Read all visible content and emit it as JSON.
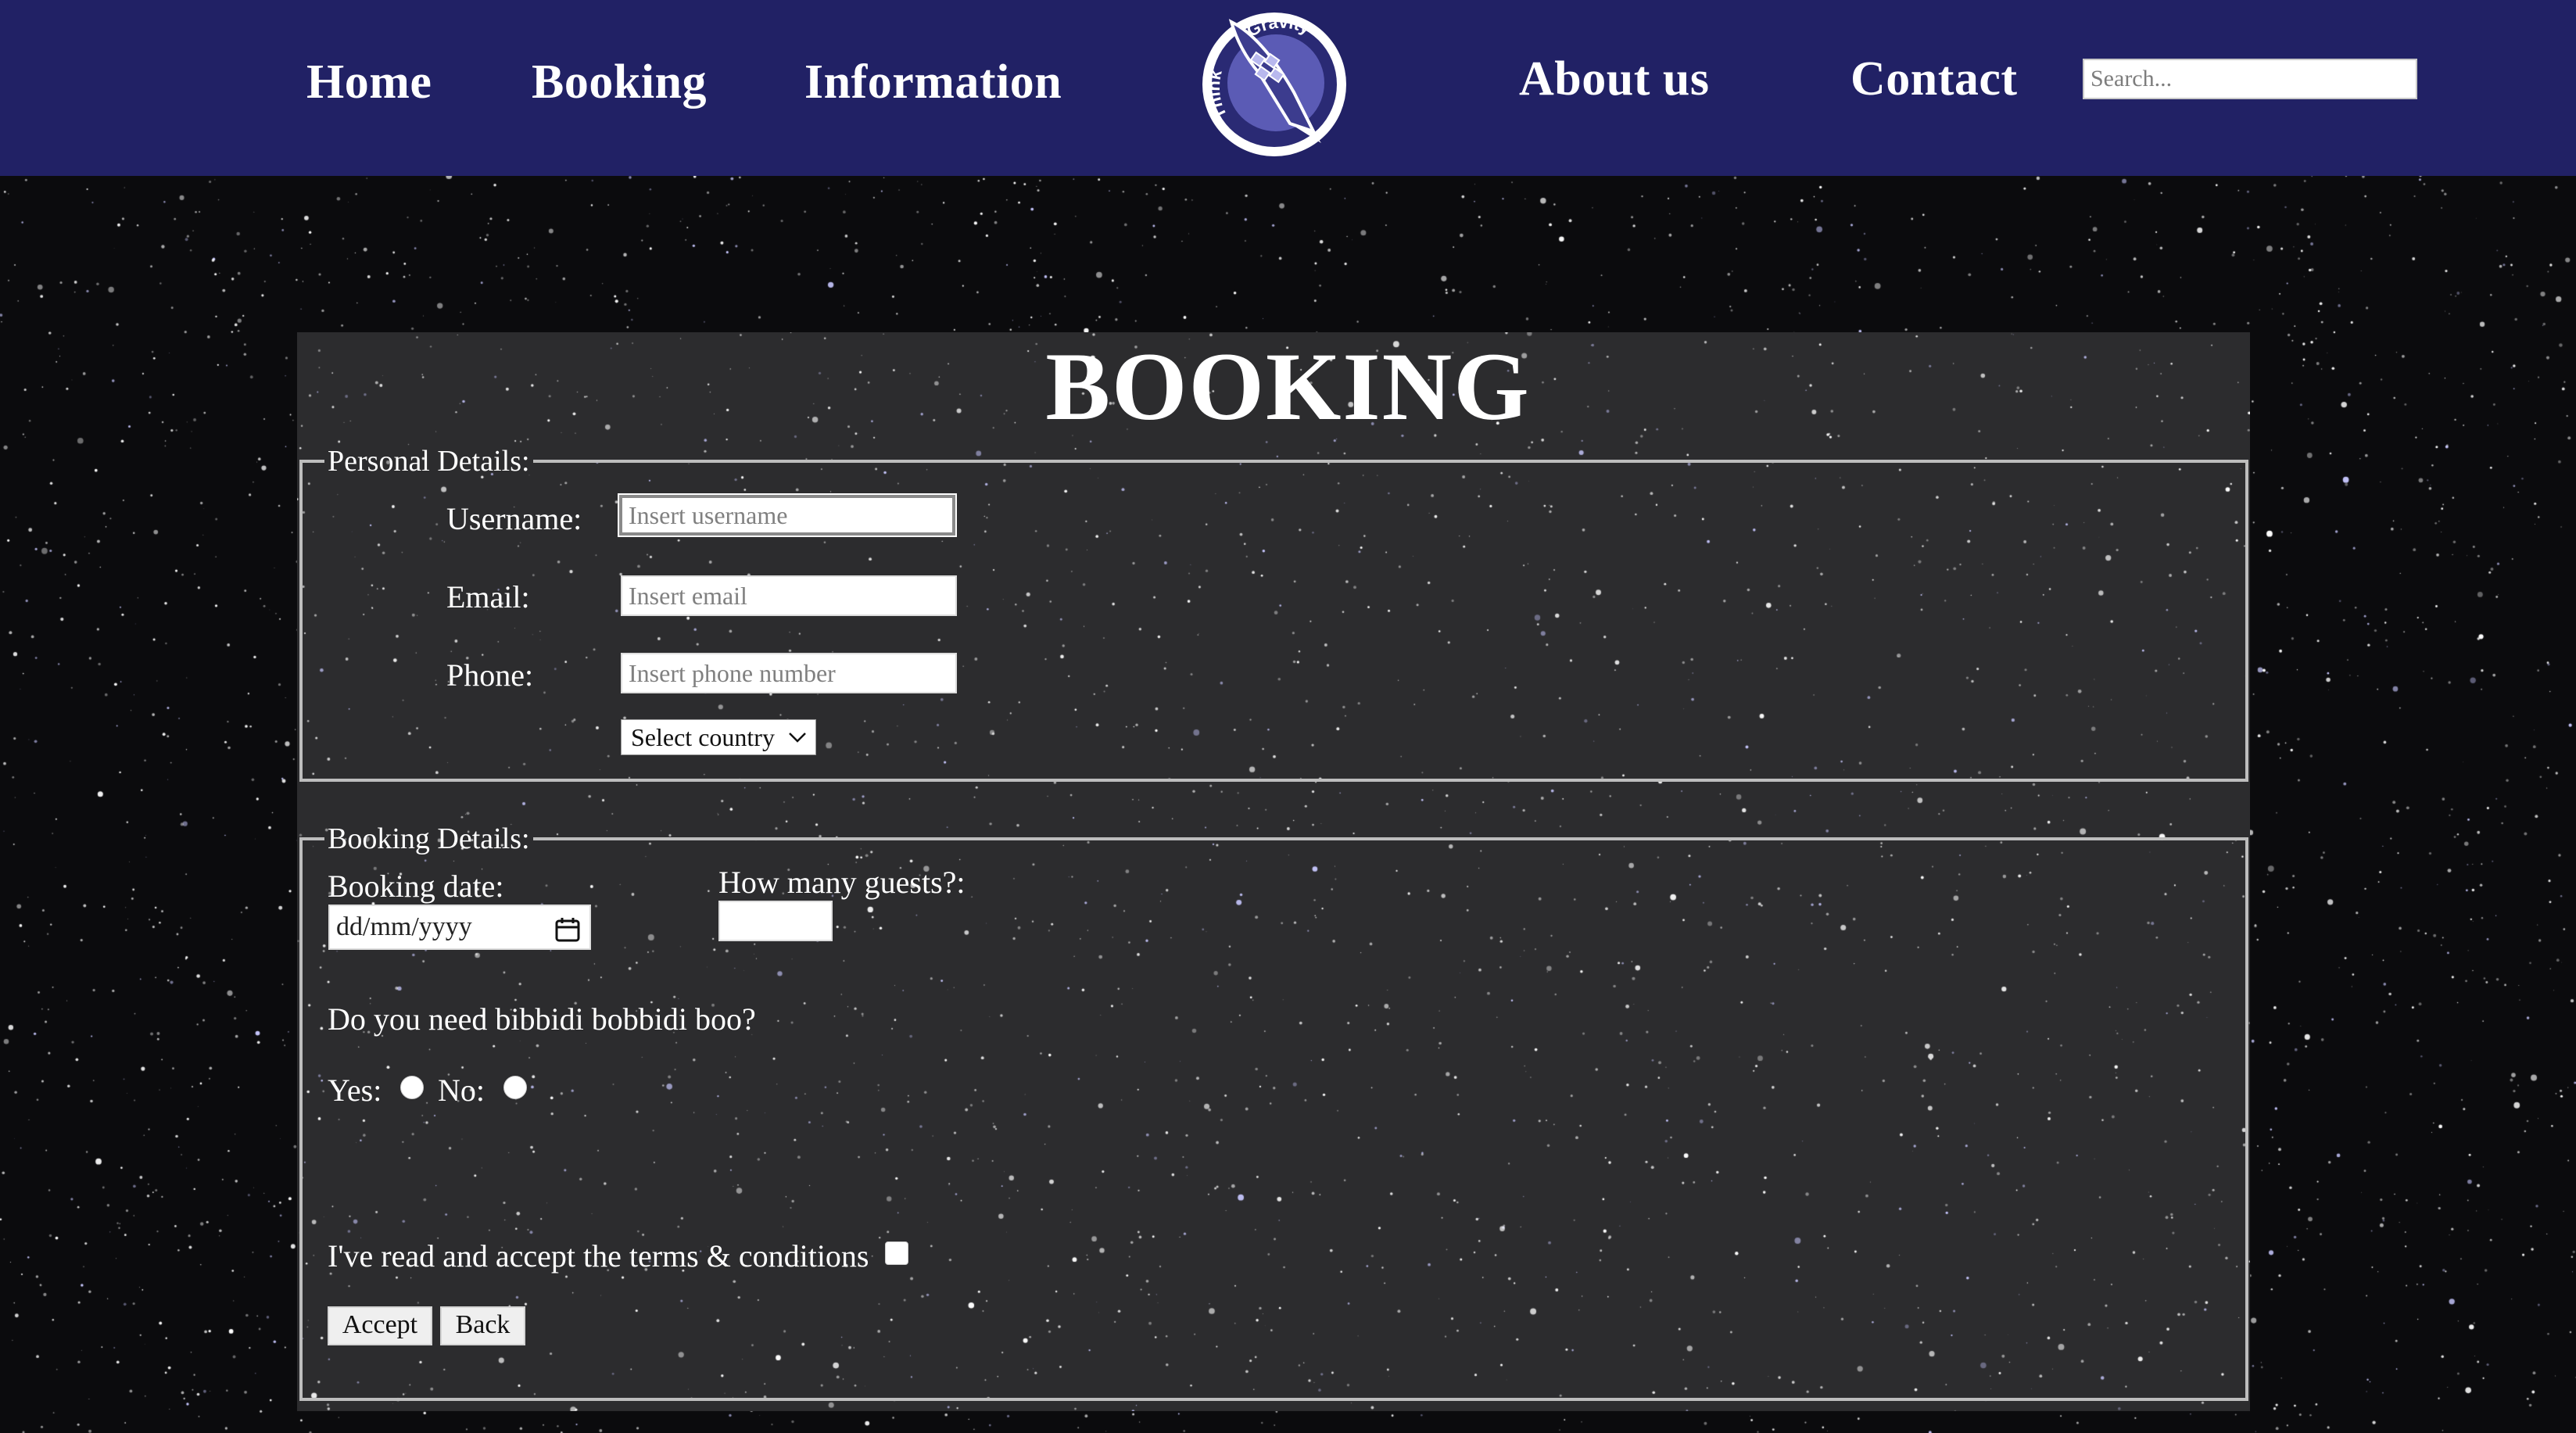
{
  "nav": {
    "links": [
      "Home",
      "Booking",
      "Information",
      "About us",
      "Contact"
    ],
    "search_placeholder": "Search...",
    "logo_text": "Think Gravity",
    "background_color": "#212165"
  },
  "page": {
    "title": "BOOKING"
  },
  "personal_details": {
    "legend": "Personal Details:",
    "username_label": "Username:",
    "username_placeholder": "Insert username",
    "email_label": "Email:",
    "email_placeholder": "Insert email",
    "phone_label": "Phone:",
    "phone_placeholder": "Insert phone number",
    "country_select": "Select country"
  },
  "booking_details": {
    "legend": "Booking Details:",
    "date_label": "Booking date:",
    "date_value": "dd/mm/yyyy",
    "guests_label": "How many guests?:",
    "bibbidi_question": "Do you need bibbidi bobbidi boo?",
    "yes_label": "Yes:",
    "no_label": "No:",
    "terms_label": "I've read and accept the terms & conditions",
    "accept_button": "Accept",
    "back_button": "Back"
  },
  "icons": {
    "select_arrow": "chevron-down-icon",
    "date_picker": "calendar-icon"
  }
}
